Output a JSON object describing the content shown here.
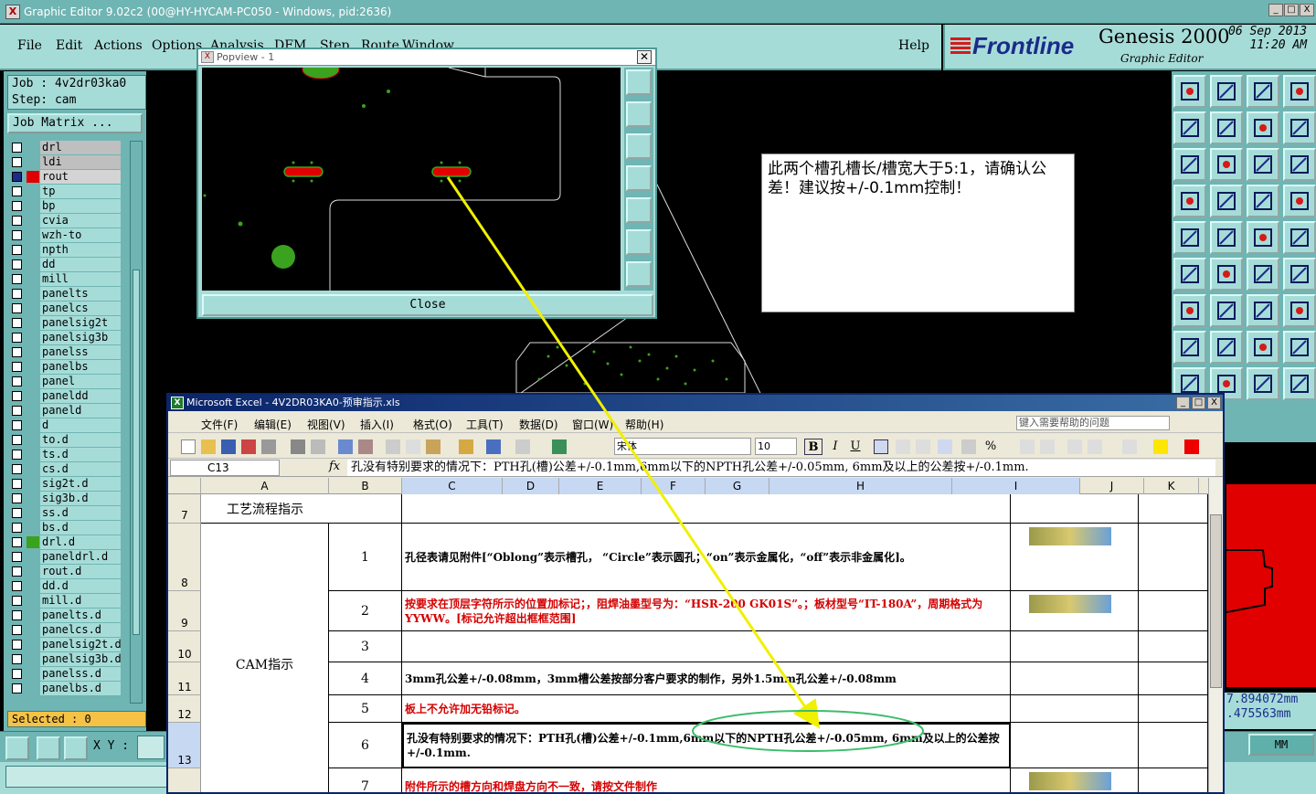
{
  "genesis": {
    "title": "Graphic Editor 9.02c2 (00@HY-HYCAM-PC050 - Windows, pid:2636)",
    "window_buttons": [
      "_",
      "□",
      "X"
    ],
    "menu": [
      "File",
      "Edit",
      "Actions",
      "Options",
      "Analysis",
      "DFM",
      "Step",
      "Route",
      "Window"
    ],
    "help": "Help",
    "brand": {
      "logo": "Frontline",
      "product": "Genesis 2000",
      "subtitle": "Graphic Editor",
      "date": "06  Sep  2013",
      "time": "11:20  AM"
    },
    "job_line": "Job : 4v2dr03ka0",
    "step_line": "Step: cam",
    "job_matrix": "Job Matrix ...",
    "layers": [
      {
        "name": "drl",
        "checked": false,
        "swatch": "",
        "style": "grey"
      },
      {
        "name": "ldi",
        "checked": false,
        "swatch": "",
        "style": "grey"
      },
      {
        "name": "rout",
        "checked": true,
        "swatch": "#e00000",
        "style": "sel"
      },
      {
        "name": "tp",
        "checked": false,
        "swatch": "",
        "style": ""
      },
      {
        "name": "bp",
        "checked": false,
        "swatch": "",
        "style": ""
      },
      {
        "name": "cvia",
        "checked": false,
        "swatch": "",
        "style": ""
      },
      {
        "name": "wzh-to",
        "checked": false,
        "swatch": "",
        "style": ""
      },
      {
        "name": "npth",
        "checked": false,
        "swatch": "",
        "style": ""
      },
      {
        "name": "dd",
        "checked": false,
        "swatch": "",
        "style": ""
      },
      {
        "name": "mill",
        "checked": false,
        "swatch": "",
        "style": ""
      },
      {
        "name": "panelts",
        "checked": false,
        "swatch": "",
        "style": ""
      },
      {
        "name": "panelcs",
        "checked": false,
        "swatch": "",
        "style": ""
      },
      {
        "name": "panelsig2t",
        "checked": false,
        "swatch": "",
        "style": ""
      },
      {
        "name": "panelsig3b",
        "checked": false,
        "swatch": "",
        "style": ""
      },
      {
        "name": "panelss",
        "checked": false,
        "swatch": "",
        "style": ""
      },
      {
        "name": "panelbs",
        "checked": false,
        "swatch": "",
        "style": ""
      },
      {
        "name": "panel",
        "checked": false,
        "swatch": "",
        "style": ""
      },
      {
        "name": "paneldd",
        "checked": false,
        "swatch": "",
        "style": ""
      },
      {
        "name": "paneld",
        "checked": false,
        "swatch": "",
        "style": ""
      },
      {
        "name": "d",
        "checked": false,
        "swatch": "",
        "style": ""
      },
      {
        "name": "to.d",
        "checked": false,
        "swatch": "",
        "style": ""
      },
      {
        "name": "ts.d",
        "checked": false,
        "swatch": "",
        "style": ""
      },
      {
        "name": "cs.d",
        "checked": false,
        "swatch": "",
        "style": ""
      },
      {
        "name": "sig2t.d",
        "checked": false,
        "swatch": "",
        "style": ""
      },
      {
        "name": "sig3b.d",
        "checked": false,
        "swatch": "",
        "style": ""
      },
      {
        "name": "ss.d",
        "checked": false,
        "swatch": "",
        "style": ""
      },
      {
        "name": "bs.d",
        "checked": false,
        "swatch": "",
        "style": ""
      },
      {
        "name": "drl.d",
        "checked": false,
        "swatch": "#3aa21e",
        "style": ""
      },
      {
        "name": "paneldrl.d",
        "checked": false,
        "swatch": "",
        "style": ""
      },
      {
        "name": "rout.d",
        "checked": false,
        "swatch": "",
        "style": ""
      },
      {
        "name": "dd.d",
        "checked": false,
        "swatch": "",
        "style": ""
      },
      {
        "name": "mill.d",
        "checked": false,
        "swatch": "",
        "style": ""
      },
      {
        "name": "panelts.d",
        "checked": false,
        "swatch": "",
        "style": ""
      },
      {
        "name": "panelcs.d",
        "checked": false,
        "swatch": "",
        "style": ""
      },
      {
        "name": "panelsig2t.d",
        "checked": false,
        "swatch": "",
        "style": ""
      },
      {
        "name": "panelsig3b.d",
        "checked": false,
        "swatch": "",
        "style": ""
      },
      {
        "name": "panelss.d",
        "checked": false,
        "swatch": "",
        "style": ""
      },
      {
        "name": "panelbs.d",
        "checked": false,
        "swatch": "",
        "style": ""
      }
    ],
    "selected": "Selected : 0",
    "xy_label": "X Y :",
    "coords": [
      "7.894072mm",
      ".475563mm"
    ],
    "units": "MM"
  },
  "popview": {
    "title": "Popview - 1",
    "close_label": "Close"
  },
  "note": "此两个槽孔槽长/槽宽大于5:1，请确认公差！建议按+/-0.1mm控制！",
  "excel": {
    "title": "Microsoft Excel - 4V2DR03KA0-预审指示.xls",
    "menu": [
      "文件(F)",
      "编辑(E)",
      "视图(V)",
      "插入(I)",
      "格式(O)",
      "工具(T)",
      "数据(D)",
      "窗口(W)",
      "帮助(H)"
    ],
    "help_box": "键入需要帮助的问题",
    "font": "宋体",
    "size": "10",
    "name_box": "C13",
    "fx": "fx",
    "formula": "孔没有特别要求的情况下：PTH孔(槽)公差+/-0.1mm,6mm以下的NPTH孔公差+/-0.05mm, 6mm及以上的公差按+/-0.1mm.",
    "columns": [
      "A",
      "B",
      "C",
      "D",
      "E",
      "F",
      "G",
      "H",
      "I",
      "J",
      "K"
    ],
    "rows": [
      {
        "num": "7",
        "a": "工艺流程指示",
        "b": "",
        "c": "",
        "style": ""
      },
      {
        "num": "8",
        "a": "",
        "b": "1",
        "c": "孔径表请见附件[“Oblong”表示槽孔，  “Circle”表示圆孔；“on”表示金属化，“off”表示非金属化]。",
        "style": "bold"
      },
      {
        "num": "9",
        "a": "",
        "b": "2",
        "c": "按要求在顶层字符所示的位置加标记；，阻焊油墨型号为：“HSR-200 GK01S”。；板材型号“IT-180A”，周期格式为YYWW。[标记允许超出框框范围]",
        "style": "red"
      },
      {
        "num": "10",
        "a": "",
        "b": "3",
        "c": "",
        "style": ""
      },
      {
        "num": "11",
        "a": "CAM指示",
        "b": "4",
        "c": "3mm孔公差+/-0.08mm，3mm槽公差按部分客户要求的制作，另外1.5mm孔公差+/-0.08mm",
        "style": "bold"
      },
      {
        "num": "12",
        "a": "",
        "b": "5",
        "c": "板上不允许加无铅标记。",
        "style": "red"
      },
      {
        "num": "13",
        "a": "",
        "b": "6",
        "c": "孔没有特别要求的情况下：PTH孔(槽)公差+/-0.1mm,6mm以下的NPTH孔公差+/-0.05mm, 6mm及以上的公差按+/-0.1mm.",
        "style": "bold"
      },
      {
        "num": "",
        "a": "",
        "b": "7",
        "c": "附件所示的槽方向和焊盘方向不一致，请按文件制作",
        "style": "red"
      }
    ]
  },
  "colors": {
    "teal": "#6fb5b3",
    "teal_light": "#a6dcd8",
    "annotation_arrow": "#f0f000",
    "ellipse": "#3dbd6a",
    "slot_red": "#e10000",
    "pad_green": "#3aa21e"
  }
}
